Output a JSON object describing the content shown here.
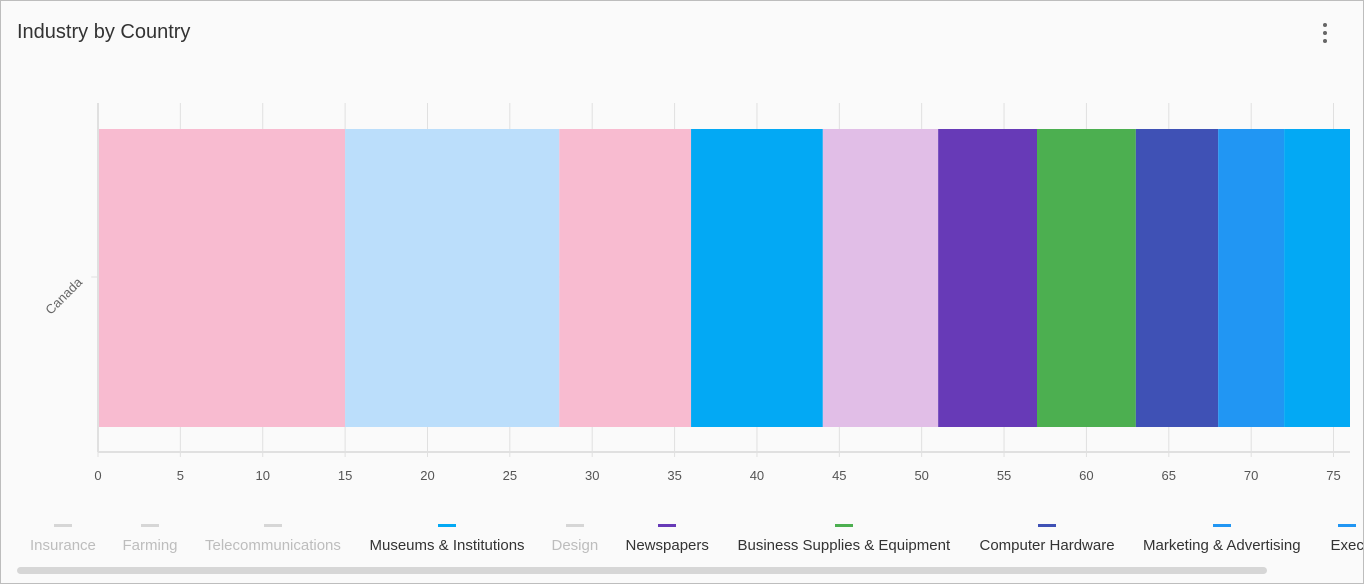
{
  "header": {
    "title": "Industry by Country",
    "menu_icon": "more-vert-icon"
  },
  "chart_data": {
    "type": "bar",
    "orientation": "horizontal",
    "stacked": true,
    "title": "Industry by Country",
    "categories": [
      "Canada"
    ],
    "xlim": [
      0,
      76
    ],
    "xticks": [
      0,
      5,
      10,
      15,
      20,
      25,
      30,
      35,
      40,
      45,
      50,
      55,
      60,
      65,
      70,
      75
    ],
    "grid": true,
    "legend_position": "bottom",
    "series": [
      {
        "name": "Insurance",
        "values": [
          15
        ],
        "color": "#f8bbd0",
        "visible": true
      },
      {
        "name": "Farming",
        "values": [
          13
        ],
        "color": "#bbdefb",
        "visible": true
      },
      {
        "name": "Telecommunications",
        "values": [
          8
        ],
        "color": "#f8bbd0",
        "visible": true
      },
      {
        "name": "Museums & Institutions",
        "values": [
          8
        ],
        "color": "#03a9f4",
        "visible": true
      },
      {
        "name": "Design",
        "values": [
          7
        ],
        "color": "#e1bee7",
        "visible": true
      },
      {
        "name": "Newspapers",
        "values": [
          6
        ],
        "color": "#673ab7",
        "visible": true
      },
      {
        "name": "Business Supplies & Equipment",
        "values": [
          6
        ],
        "color": "#4caf50",
        "visible": true
      },
      {
        "name": "Computer Hardware",
        "values": [
          5
        ],
        "color": "#3f51b5",
        "visible": true
      },
      {
        "name": "Marketing & Advertising",
        "values": [
          4
        ],
        "color": "#2196f3",
        "visible": true
      },
      {
        "name": "Exec",
        "values": [
          4
        ],
        "color": "#03a9f4",
        "visible": true
      }
    ]
  },
  "legend": {
    "items": [
      {
        "label": "Insurance",
        "color": "#d6d6d6",
        "active": false
      },
      {
        "label": "Farming",
        "color": "#d6d6d6",
        "active": false
      },
      {
        "label": "Telecommunications",
        "color": "#d6d6d6",
        "active": false
      },
      {
        "label": "Museums & Institutions",
        "color": "#03a9f4",
        "active": true
      },
      {
        "label": "Design",
        "color": "#d6d6d6",
        "active": false
      },
      {
        "label": "Newspapers",
        "color": "#673ab7",
        "active": true
      },
      {
        "label": "Business Supplies & Equipment",
        "color": "#4caf50",
        "active": true
      },
      {
        "label": "Computer Hardware",
        "color": "#3f51b5",
        "active": true
      },
      {
        "label": "Marketing & Advertising",
        "color": "#2196f3",
        "active": true
      },
      {
        "label": "Exec",
        "color": "#2196f3",
        "active": true
      }
    ]
  }
}
